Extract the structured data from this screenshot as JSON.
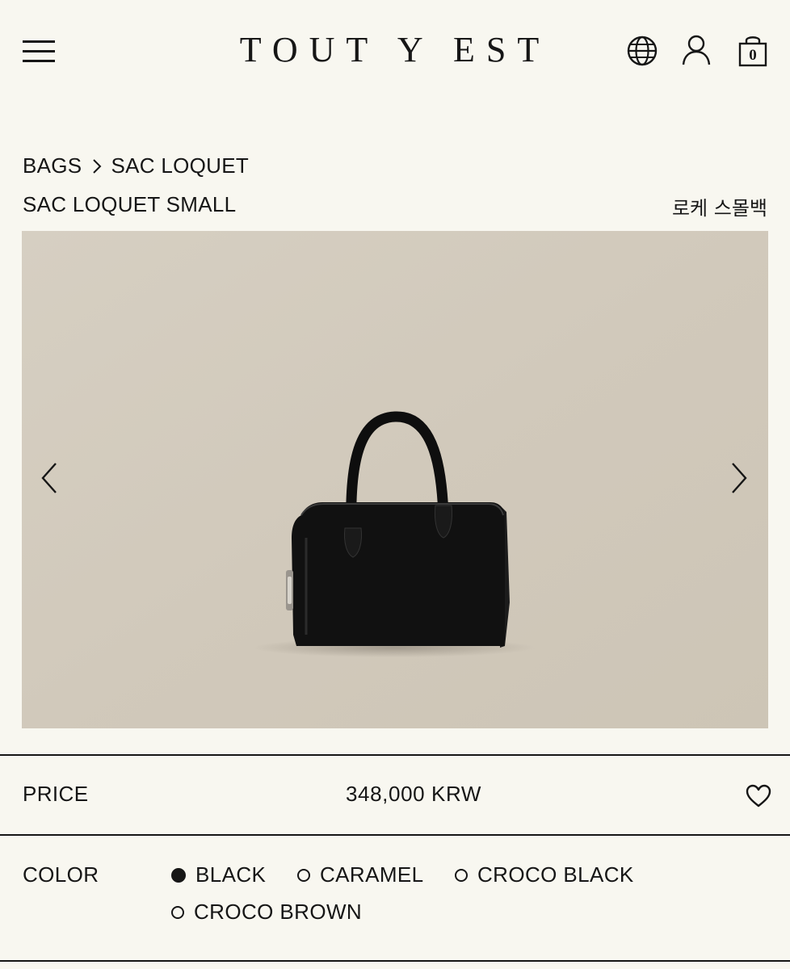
{
  "header": {
    "logo": "TOUT Y EST",
    "cart_count": "0",
    "icons": [
      "menu-icon",
      "globe-icon",
      "user-icon",
      "shopping-bag-icon"
    ]
  },
  "breadcrumb": {
    "items": [
      "BAGS",
      "SAC LOQUET"
    ],
    "separator_icon": "chevron-right-icon"
  },
  "product": {
    "name": "SAC LOQUET SMALL",
    "name_kr": "로케 스몰백",
    "price_label": "PRICE",
    "price": "348,000 KRW",
    "color_label": "COLOR",
    "colors": [
      {
        "label": "BLACK",
        "selected": true
      },
      {
        "label": "CARAMEL",
        "selected": false
      },
      {
        "label": "CROCO BLACK",
        "selected": false
      },
      {
        "label": "CROCO BROWN",
        "selected": false
      }
    ]
  },
  "gallery": {
    "image": "black leather handbag on beige background",
    "prev_icon": "chevron-left-icon",
    "next_icon": "chevron-right-icon",
    "background_color": "#d3cbbd",
    "bag_color": "#111111"
  },
  "colors": {
    "page_bg": "#f8f7f0",
    "text": "#161616"
  }
}
